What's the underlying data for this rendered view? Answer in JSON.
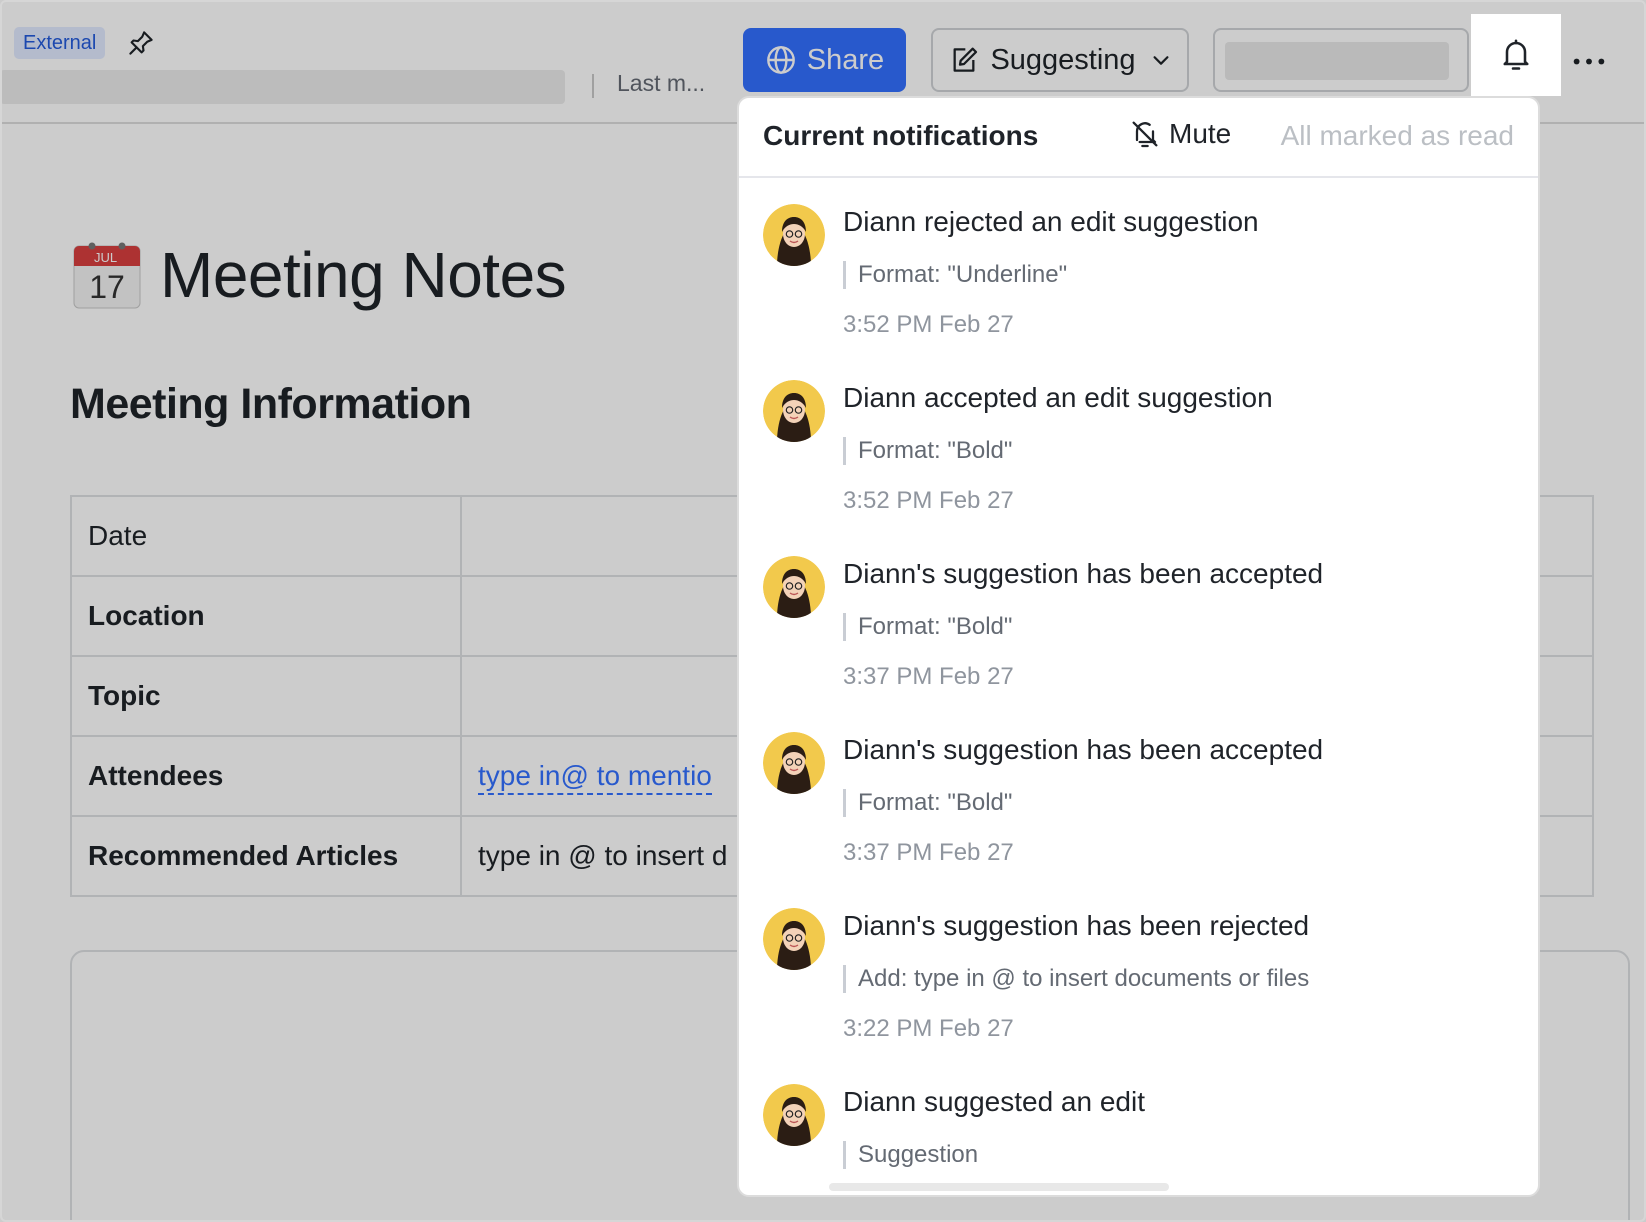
{
  "header": {
    "badge": "External",
    "last_modified": "Last m...",
    "share_label": "Share",
    "mode_label": "Suggesting"
  },
  "document": {
    "title": "Meeting Notes",
    "calendar_month": "JUL",
    "calendar_day": "17",
    "section_heading": "Meeting Information",
    "table": {
      "rows": [
        {
          "label": "Date",
          "value": ""
        },
        {
          "label": "Location",
          "value": ""
        },
        {
          "label": "Topic",
          "value": ""
        },
        {
          "label": "Attendees",
          "value": "type in@ to mentio"
        },
        {
          "label": "Recommended Articles",
          "value": "type in @ to insert d"
        }
      ]
    }
  },
  "notifications": {
    "title": "Current notifications",
    "mute_label": "Mute",
    "mark_read_label": "All marked as read",
    "items": [
      {
        "text": "Diann rejected an edit suggestion",
        "detail": "Format: \"Underline\"",
        "time": "3:52 PM Feb 27"
      },
      {
        "text": "Diann accepted an edit suggestion",
        "detail": "Format: \"Bold\"",
        "time": "3:52 PM Feb 27"
      },
      {
        "text": "Diann's suggestion has been accepted",
        "detail": "Format: \"Bold\"",
        "time": "3:37 PM Feb 27"
      },
      {
        "text": "Diann's suggestion has been accepted",
        "detail": "Format: \"Bold\"",
        "time": "3:37 PM Feb 27"
      },
      {
        "text": "Diann's suggestion has been rejected",
        "detail": "Add: type in @ to insert documents or files",
        "time": "3:22 PM Feb 27"
      },
      {
        "text": "Diann suggested an edit",
        "detail": "Suggestion",
        "time": ""
      }
    ]
  },
  "colors": {
    "accent": "#3370ff",
    "overlay": "rgba(0,0,0,0.2)"
  }
}
